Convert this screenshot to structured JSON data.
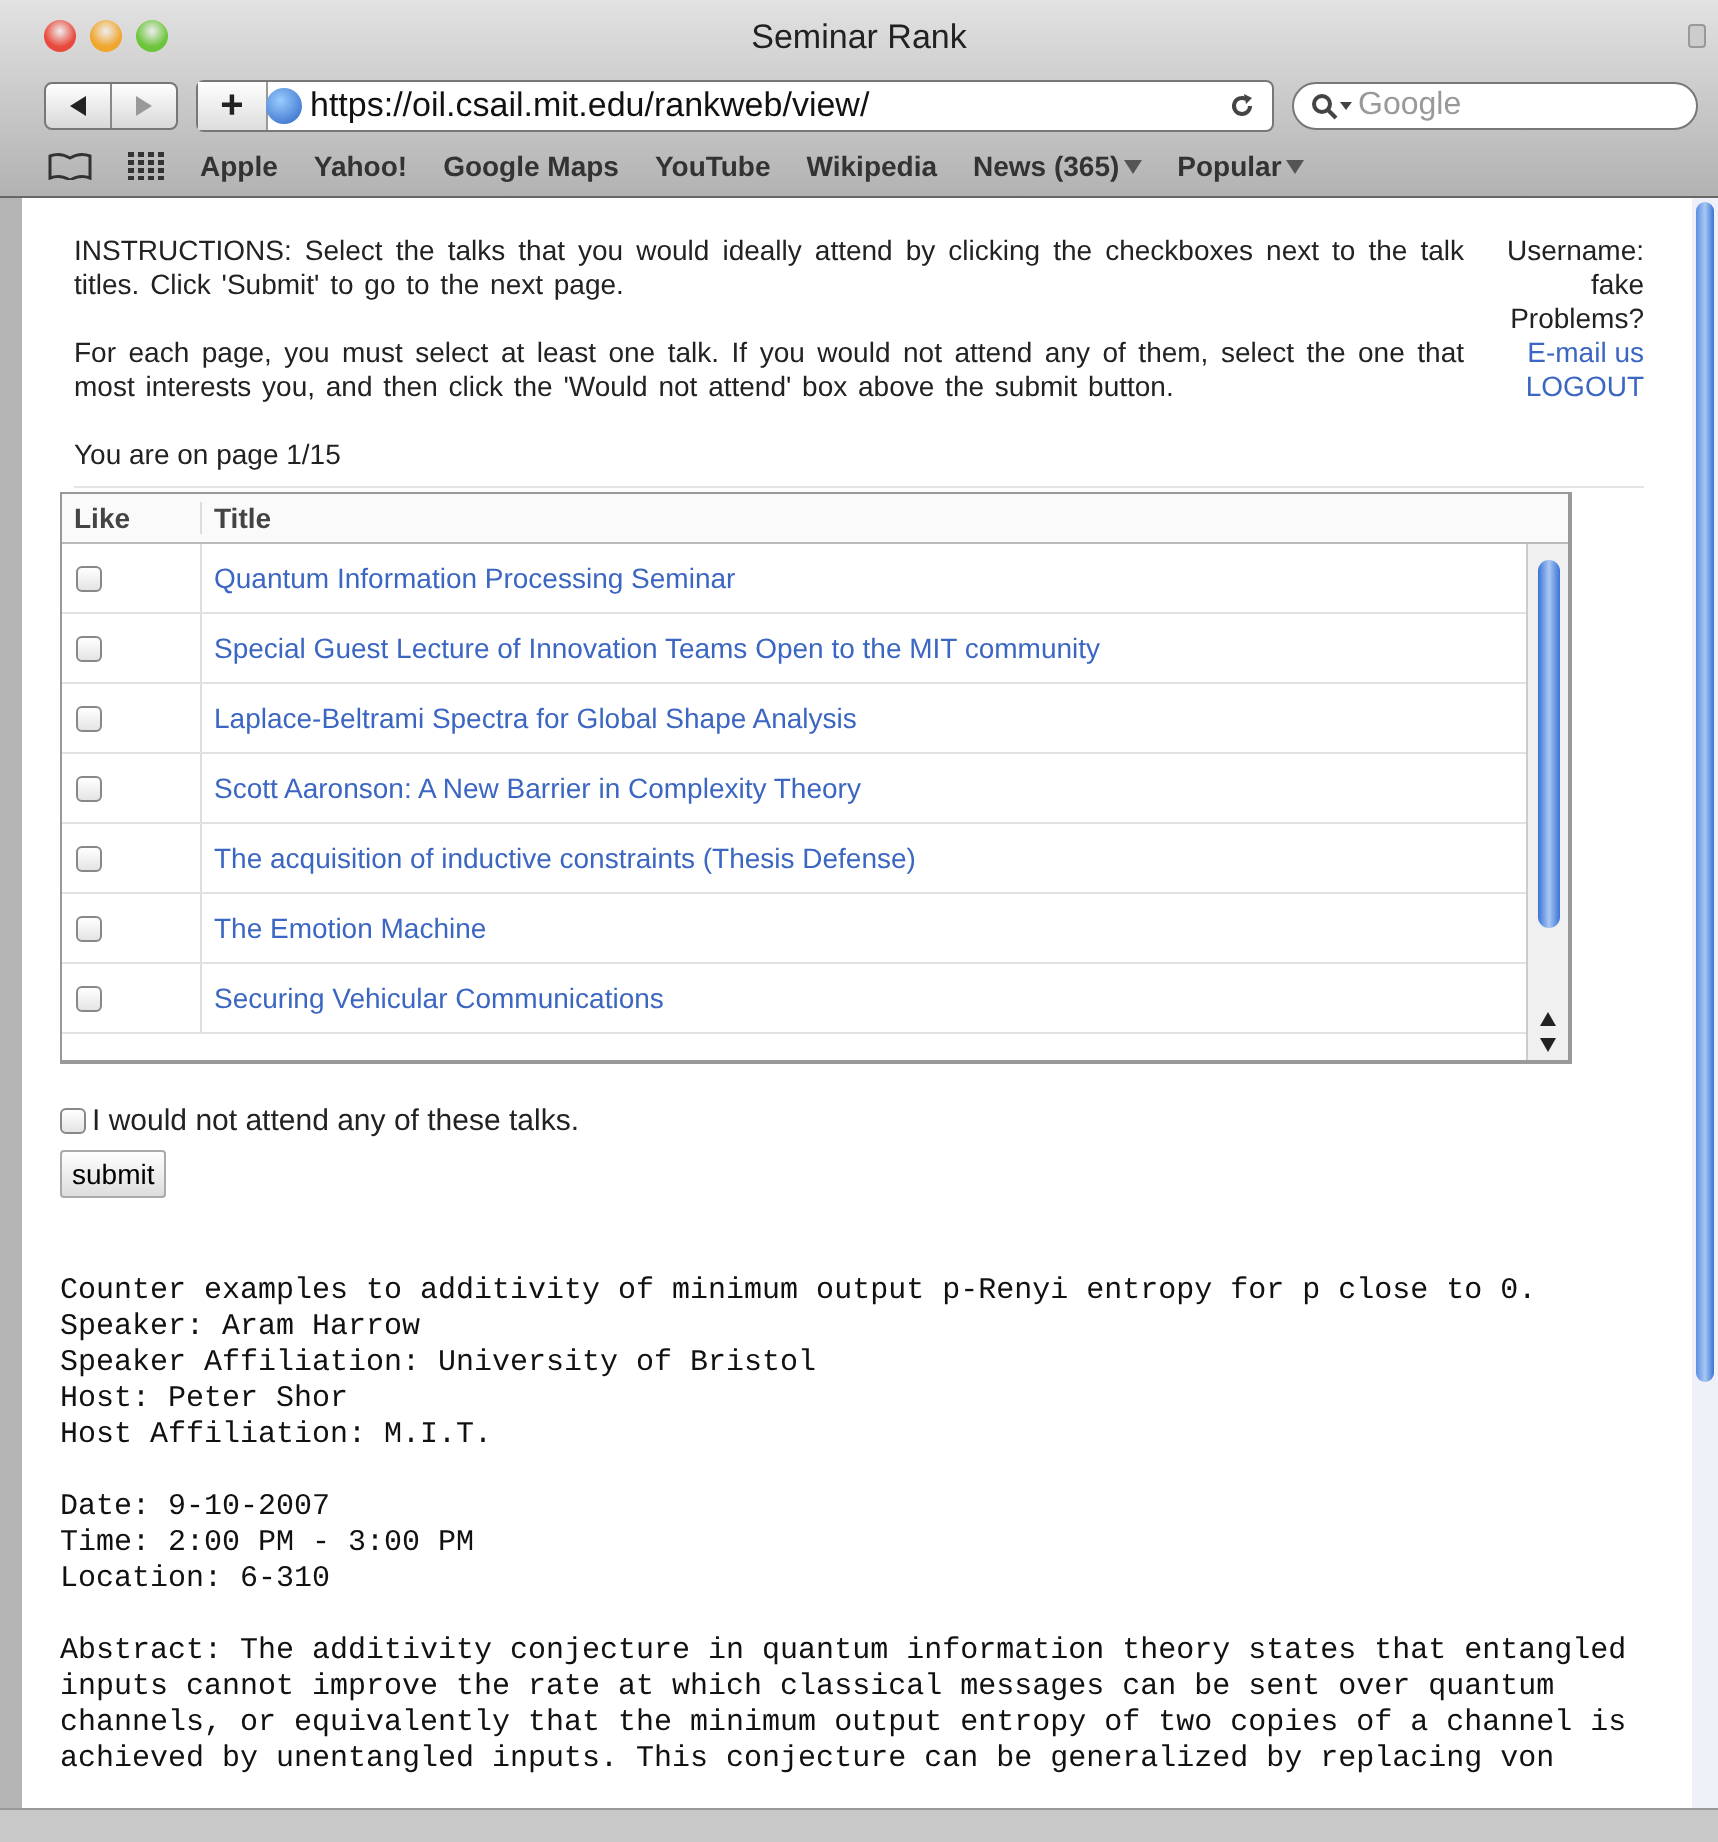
{
  "window": {
    "title": "Seminar Rank"
  },
  "toolbar": {
    "url": "https://oil.csail.mit.edu/rankweb/view/",
    "search_placeholder": "Google",
    "add_button": "+"
  },
  "bookmarks": [
    {
      "label": "Apple",
      "kind": "link"
    },
    {
      "label": "Yahoo!",
      "kind": "link"
    },
    {
      "label": "Google Maps",
      "kind": "link"
    },
    {
      "label": "YouTube",
      "kind": "link"
    },
    {
      "label": "Wikipedia",
      "kind": "link"
    },
    {
      "label": "News (365)",
      "kind": "menu"
    },
    {
      "label": "Popular",
      "kind": "menu"
    }
  ],
  "instructions": [
    "INSTRUCTIONS: Select the talks that you would ideally attend by clicking the checkboxes next to the talk titles. Click 'Submit' to go to the next page.",
    "For each page, you must select at least one talk. If you would not attend any of them, select the one that most interests you, and then click the 'Would not attend' box above the submit button."
  ],
  "user_panel": {
    "username_label": "Username:",
    "username": "fake",
    "problems": "Problems?",
    "email_link": "E-mail us",
    "logout_link": "LOGOUT"
  },
  "page_indicator": "You are on page 1/15",
  "table": {
    "columns": [
      "Like",
      "Title"
    ],
    "rows": [
      {
        "title": "Quantum Information Processing Seminar",
        "checked": false
      },
      {
        "title": "Special Guest Lecture of Innovation Teams Open to the MIT community",
        "checked": false
      },
      {
        "title": "Laplace-Beltrami Spectra for Global Shape Analysis",
        "checked": false
      },
      {
        "title": "Scott Aaronson: A New Barrier in Complexity Theory",
        "checked": false
      },
      {
        "title": "The acquisition of inductive constraints (Thesis Defense)",
        "checked": false
      },
      {
        "title": "The Emotion Machine",
        "checked": false
      },
      {
        "title": "Securing Vehicular Communications",
        "checked": false
      }
    ]
  },
  "not_attend": {
    "label": "I would not attend any of these talks.",
    "checked": false
  },
  "submit": "submit",
  "details": {
    "groups": [
      [
        "Counter examples to additivity of minimum output p-Renyi entropy for p close to 0.",
        "Speaker: Aram Harrow",
        "Speaker Affiliation: University of Bristol",
        "Host: Peter Shor",
        "Host Affiliation: M.I.T."
      ],
      [
        "Date: 9-10-2007",
        "Time: 2:00 PM - 3:00 PM",
        "Location: 6-310"
      ],
      [
        "Abstract: The additivity conjecture in quantum information theory states that entangled inputs cannot improve the rate at which classical messages can be sent over quantum channels, or equivalently that the minimum output entropy of two copies of a channel is achieved by unentangled inputs. This conjecture can be generalized by replacing von"
      ]
    ]
  }
}
